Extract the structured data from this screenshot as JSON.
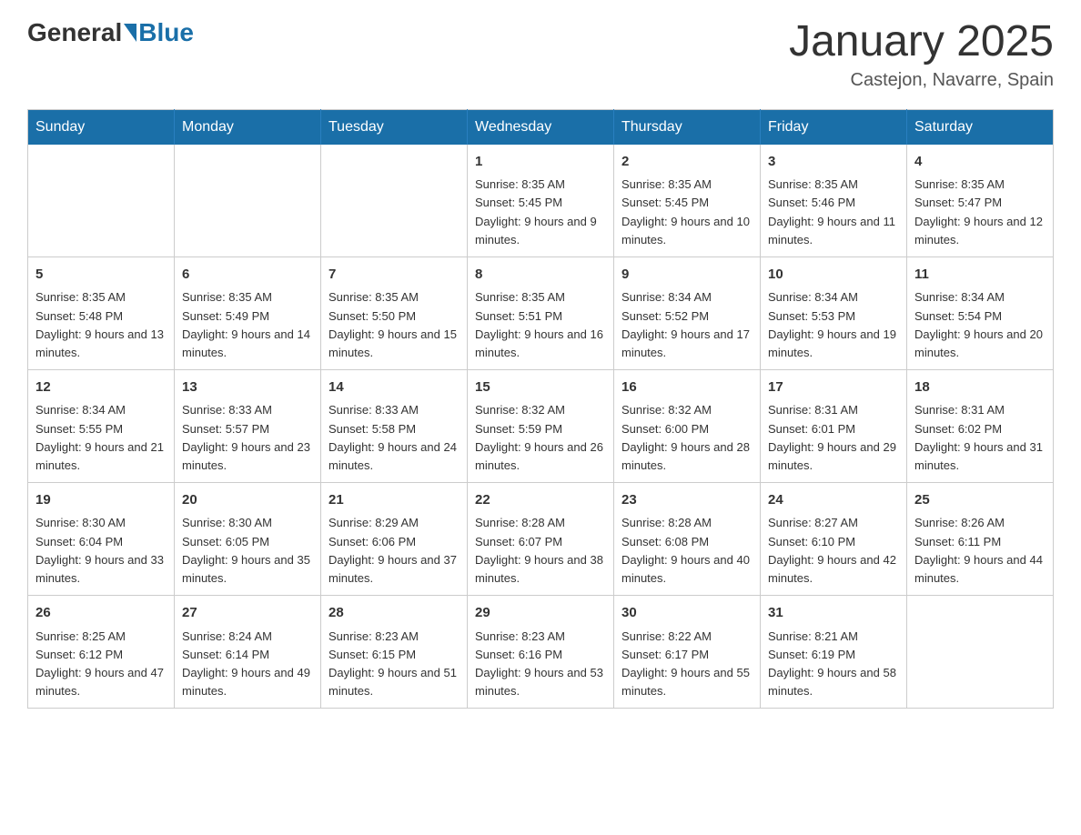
{
  "header": {
    "logo_general": "General",
    "logo_blue": "Blue",
    "title": "January 2025",
    "location": "Castejon, Navarre, Spain"
  },
  "calendar": {
    "days_of_week": [
      "Sunday",
      "Monday",
      "Tuesday",
      "Wednesday",
      "Thursday",
      "Friday",
      "Saturday"
    ],
    "weeks": [
      [
        {
          "day": "",
          "info": ""
        },
        {
          "day": "",
          "info": ""
        },
        {
          "day": "",
          "info": ""
        },
        {
          "day": "1",
          "info": "Sunrise: 8:35 AM\nSunset: 5:45 PM\nDaylight: 9 hours and 9 minutes."
        },
        {
          "day": "2",
          "info": "Sunrise: 8:35 AM\nSunset: 5:45 PM\nDaylight: 9 hours and 10 minutes."
        },
        {
          "day": "3",
          "info": "Sunrise: 8:35 AM\nSunset: 5:46 PM\nDaylight: 9 hours and 11 minutes."
        },
        {
          "day": "4",
          "info": "Sunrise: 8:35 AM\nSunset: 5:47 PM\nDaylight: 9 hours and 12 minutes."
        }
      ],
      [
        {
          "day": "5",
          "info": "Sunrise: 8:35 AM\nSunset: 5:48 PM\nDaylight: 9 hours and 13 minutes."
        },
        {
          "day": "6",
          "info": "Sunrise: 8:35 AM\nSunset: 5:49 PM\nDaylight: 9 hours and 14 minutes."
        },
        {
          "day": "7",
          "info": "Sunrise: 8:35 AM\nSunset: 5:50 PM\nDaylight: 9 hours and 15 minutes."
        },
        {
          "day": "8",
          "info": "Sunrise: 8:35 AM\nSunset: 5:51 PM\nDaylight: 9 hours and 16 minutes."
        },
        {
          "day": "9",
          "info": "Sunrise: 8:34 AM\nSunset: 5:52 PM\nDaylight: 9 hours and 17 minutes."
        },
        {
          "day": "10",
          "info": "Sunrise: 8:34 AM\nSunset: 5:53 PM\nDaylight: 9 hours and 19 minutes."
        },
        {
          "day": "11",
          "info": "Sunrise: 8:34 AM\nSunset: 5:54 PM\nDaylight: 9 hours and 20 minutes."
        }
      ],
      [
        {
          "day": "12",
          "info": "Sunrise: 8:34 AM\nSunset: 5:55 PM\nDaylight: 9 hours and 21 minutes."
        },
        {
          "day": "13",
          "info": "Sunrise: 8:33 AM\nSunset: 5:57 PM\nDaylight: 9 hours and 23 minutes."
        },
        {
          "day": "14",
          "info": "Sunrise: 8:33 AM\nSunset: 5:58 PM\nDaylight: 9 hours and 24 minutes."
        },
        {
          "day": "15",
          "info": "Sunrise: 8:32 AM\nSunset: 5:59 PM\nDaylight: 9 hours and 26 minutes."
        },
        {
          "day": "16",
          "info": "Sunrise: 8:32 AM\nSunset: 6:00 PM\nDaylight: 9 hours and 28 minutes."
        },
        {
          "day": "17",
          "info": "Sunrise: 8:31 AM\nSunset: 6:01 PM\nDaylight: 9 hours and 29 minutes."
        },
        {
          "day": "18",
          "info": "Sunrise: 8:31 AM\nSunset: 6:02 PM\nDaylight: 9 hours and 31 minutes."
        }
      ],
      [
        {
          "day": "19",
          "info": "Sunrise: 8:30 AM\nSunset: 6:04 PM\nDaylight: 9 hours and 33 minutes."
        },
        {
          "day": "20",
          "info": "Sunrise: 8:30 AM\nSunset: 6:05 PM\nDaylight: 9 hours and 35 minutes."
        },
        {
          "day": "21",
          "info": "Sunrise: 8:29 AM\nSunset: 6:06 PM\nDaylight: 9 hours and 37 minutes."
        },
        {
          "day": "22",
          "info": "Sunrise: 8:28 AM\nSunset: 6:07 PM\nDaylight: 9 hours and 38 minutes."
        },
        {
          "day": "23",
          "info": "Sunrise: 8:28 AM\nSunset: 6:08 PM\nDaylight: 9 hours and 40 minutes."
        },
        {
          "day": "24",
          "info": "Sunrise: 8:27 AM\nSunset: 6:10 PM\nDaylight: 9 hours and 42 minutes."
        },
        {
          "day": "25",
          "info": "Sunrise: 8:26 AM\nSunset: 6:11 PM\nDaylight: 9 hours and 44 minutes."
        }
      ],
      [
        {
          "day": "26",
          "info": "Sunrise: 8:25 AM\nSunset: 6:12 PM\nDaylight: 9 hours and 47 minutes."
        },
        {
          "day": "27",
          "info": "Sunrise: 8:24 AM\nSunset: 6:14 PM\nDaylight: 9 hours and 49 minutes."
        },
        {
          "day": "28",
          "info": "Sunrise: 8:23 AM\nSunset: 6:15 PM\nDaylight: 9 hours and 51 minutes."
        },
        {
          "day": "29",
          "info": "Sunrise: 8:23 AM\nSunset: 6:16 PM\nDaylight: 9 hours and 53 minutes."
        },
        {
          "day": "30",
          "info": "Sunrise: 8:22 AM\nSunset: 6:17 PM\nDaylight: 9 hours and 55 minutes."
        },
        {
          "day": "31",
          "info": "Sunrise: 8:21 AM\nSunset: 6:19 PM\nDaylight: 9 hours and 58 minutes."
        },
        {
          "day": "",
          "info": ""
        }
      ]
    ]
  }
}
